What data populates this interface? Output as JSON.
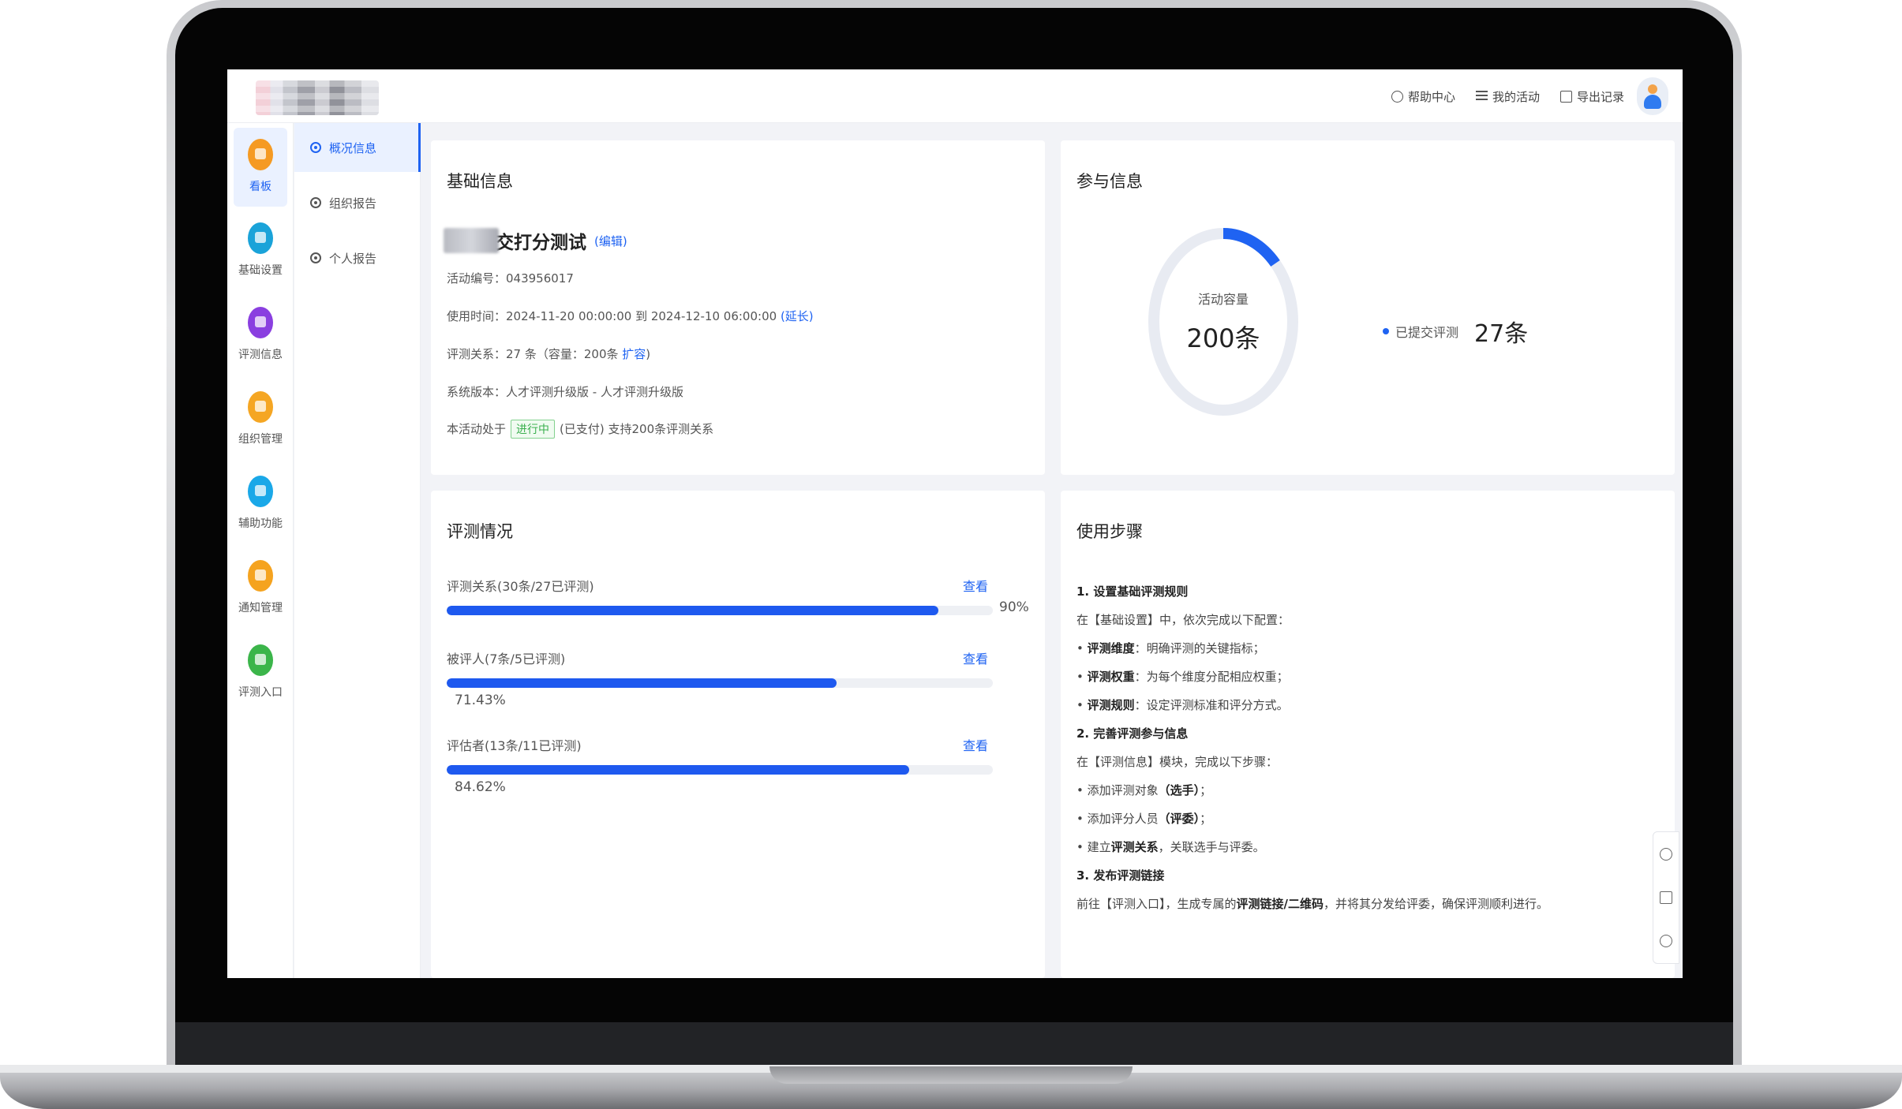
{
  "topbar": {
    "help": "帮助中心",
    "my_activities": "我的活动",
    "export_records": "导出记录"
  },
  "rail": {
    "items": [
      {
        "label": "看板",
        "icon": "dashboard-icon",
        "color": "#f59a23"
      },
      {
        "label": "基础设置",
        "icon": "settings-icon",
        "color": "#1aa3d9"
      },
      {
        "label": "评测信息",
        "icon": "assessment-info-icon",
        "color": "#8a3fe0"
      },
      {
        "label": "组织管理",
        "icon": "organization-icon",
        "color": "#f5a623"
      },
      {
        "label": "辅助功能",
        "icon": "assist-icon",
        "color": "#1aa8e8"
      },
      {
        "label": "通知管理",
        "icon": "notification-icon",
        "color": "#f5a31f"
      },
      {
        "label": "评测入口",
        "icon": "entry-icon",
        "color": "#3bb54a"
      }
    ]
  },
  "subnav": {
    "items": [
      "概况信息",
      "组织报告",
      "个人报告"
    ]
  },
  "basic": {
    "title": "基础信息",
    "activity_name": "交打分测试",
    "edit": "(编辑)",
    "code_row": "活动编号：043956017",
    "time_row": "使用时间：2024-11-20 00:00:00 到 2024-12-10 06:00:00",
    "extend": "(延长)",
    "relation_row": "评测关系：27 条（容量：200条",
    "expand": "扩容",
    "relation_end": ")",
    "version_row": "系统版本：人才评测升级版 - 人才评测升级版",
    "status_prefix": "本活动处于",
    "status_badge": "进行中",
    "status_suffix": "(已支付) 支持200条评测关系"
  },
  "participation": {
    "title": "参与信息",
    "capacity_label": "活动容量",
    "capacity_value": "200条",
    "submitted_label": "已提交评测",
    "submitted_value": "27条",
    "submitted_count": 27,
    "capacity_count": 200,
    "ring_color": "#1f63f2",
    "track_color": "#e8ebf2"
  },
  "evaluation": {
    "title": "评测情况",
    "view": "查看",
    "rows": [
      {
        "label": "评测关系(30条/27已评测)",
        "percent_text": "90%",
        "percent": 90
      },
      {
        "label": "被评人(7条/5已评测)",
        "percent_text": "71.43%",
        "percent": 71.43
      },
      {
        "label": "评估者(13条/11已评测)",
        "percent_text": "84.62%",
        "percent": 84.62
      }
    ]
  },
  "steps": {
    "title": "使用步骤",
    "s1_title": "1. 设置基础评测规则",
    "s1_intro": "在【基础设置】中，依次完成以下配置：",
    "s1_a_b": "评测维度",
    "s1_a": "：明确评测的关键指标；",
    "s1_b_b": "评测权重",
    "s1_b": "：为每个维度分配相应权重；",
    "s1_c_b": "评测规则",
    "s1_c": "：设定评测标准和评分方式。",
    "s2_title": "2. 完善评测参与信息",
    "s2_intro": "在【评测信息】模块，完成以下步骤：",
    "s2_a1": "添加评测对象",
    "s2_a_b": "（选手）",
    "s2_a2": "；",
    "s2_b1": "添加评分人员",
    "s2_b_b": "（评委）",
    "s2_b2": "；",
    "s2_c1": "建立",
    "s2_c_b": "评测关系",
    "s2_c2": "，关联选手与评委。",
    "s3_title": "3. 发布评测链接",
    "s3_1": "前往【评测入口】，生成专属的",
    "s3_b": "评测链接/二维码",
    "s3_2": "，并将其分发给评委，确保评测顺利进行。"
  }
}
